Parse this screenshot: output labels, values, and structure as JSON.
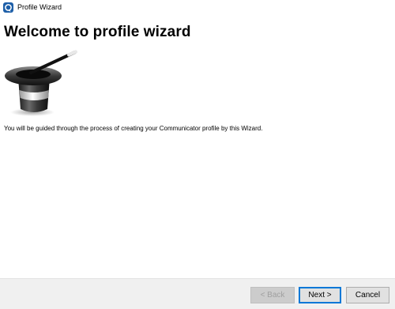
{
  "window": {
    "title": "Profile Wizard",
    "icon": "app-icon"
  },
  "page": {
    "heading": "Welcome to profile wizard",
    "image": "magic-hat-icon",
    "description": "You will be guided through the process of creating your Communicator profile by this Wizard."
  },
  "buttons": {
    "back": "< Back",
    "next": "Next >",
    "cancel": "Cancel"
  },
  "colors": {
    "accent": "#0078d7",
    "footer_bg": "#f0f0f0"
  }
}
